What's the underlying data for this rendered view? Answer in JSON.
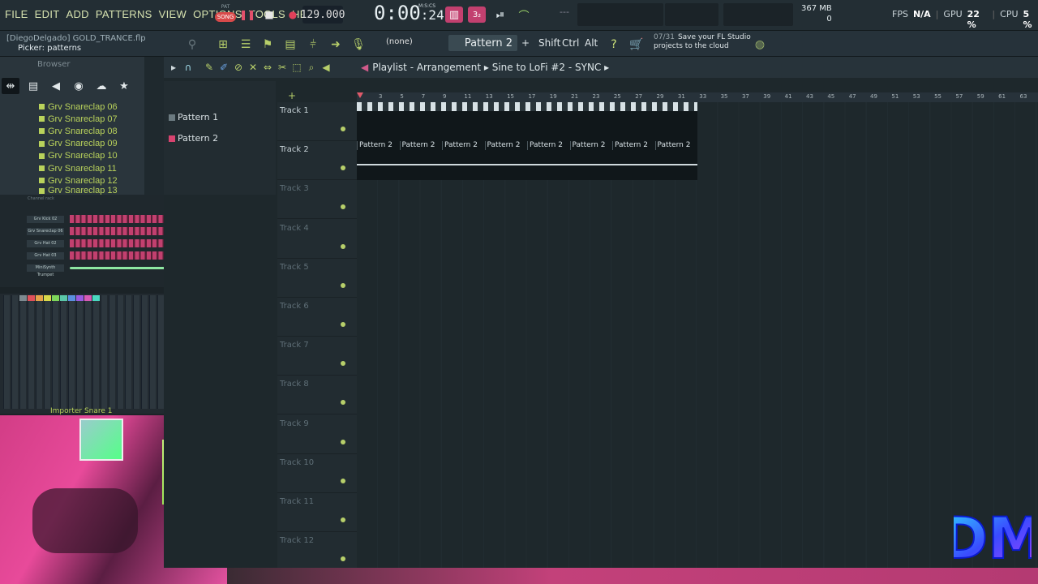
{
  "menu": [
    "FILE",
    "EDIT",
    "ADD",
    "PATTERNS",
    "VIEW",
    "OPTIONS",
    "TOOLS",
    "HELP"
  ],
  "mode": {
    "pat": "PAT",
    "song": "SONG"
  },
  "tempo": "129.000",
  "clock": {
    "main": "0:00",
    "sub": ":24",
    "unit": "M:S:CS"
  },
  "memory": {
    "value": "367 MB",
    "sub": "0"
  },
  "stats": {
    "fps_label": "FPS",
    "fps": "N/A",
    "gpu_label": "GPU",
    "gpu": "22 %",
    "cpu_label": "CPU",
    "cpu": "5 %"
  },
  "project": {
    "file": "[DiegoDelgado] GOLD_TRANCE.flp",
    "hint": "Picker: patterns"
  },
  "toolbar2": {
    "none": "(none)",
    "pattern": "Pattern 2",
    "plus": "+",
    "shift": "Shift",
    "ctrl": "Ctrl",
    "alt": "Alt"
  },
  "news": {
    "count": "07/31",
    "line1": "Save your FL Studio",
    "line2": "projects to the cloud"
  },
  "browser": {
    "title": "Browser",
    "items": [
      "Grv Snareclap 06",
      "Grv Snareclap 07",
      "Grv Snareclap 08",
      "Grv Snareclap 09",
      "Grv Snareclap 10",
      "Grv Snareclap 11",
      "Grv Snareclap 12",
      "Grv Snareclap 13"
    ]
  },
  "picker": {
    "items": [
      {
        "name": "Pattern 1",
        "color": "#6b7a80"
      },
      {
        "name": "Pattern 2",
        "color": "#d8436f"
      }
    ]
  },
  "rack": {
    "title": "Channel rack",
    "channels": [
      "Grv Kick 02",
      "Grv Snareclap 06",
      "Grv Hat 02",
      "Grv Hat 03",
      "MiniSynth Trumpet"
    ]
  },
  "mixer": {
    "label": "Importer Snare 1"
  },
  "playlist": {
    "title": "Playlist - Arrangement",
    "pattern": "Sine to LoFi #2 - SYNC",
    "tracks": [
      "Track 1",
      "Track 2",
      "Track 3",
      "Track 4",
      "Track 5",
      "Track 6",
      "Track 7",
      "Track 8",
      "Track 9",
      "Track 10",
      "Track 11",
      "Track 12"
    ],
    "ruler": [
      "3",
      "5",
      "7",
      "9",
      "11",
      "13",
      "15",
      "17",
      "19",
      "21",
      "23",
      "25",
      "27",
      "29",
      "31",
      "33",
      "35",
      "37",
      "39",
      "41",
      "43",
      "45",
      "47",
      "49",
      "51",
      "53",
      "55",
      "57",
      "59",
      "61",
      "63"
    ],
    "clip_label": "Pattern 2",
    "clip_count": 8
  },
  "logo": "DM"
}
